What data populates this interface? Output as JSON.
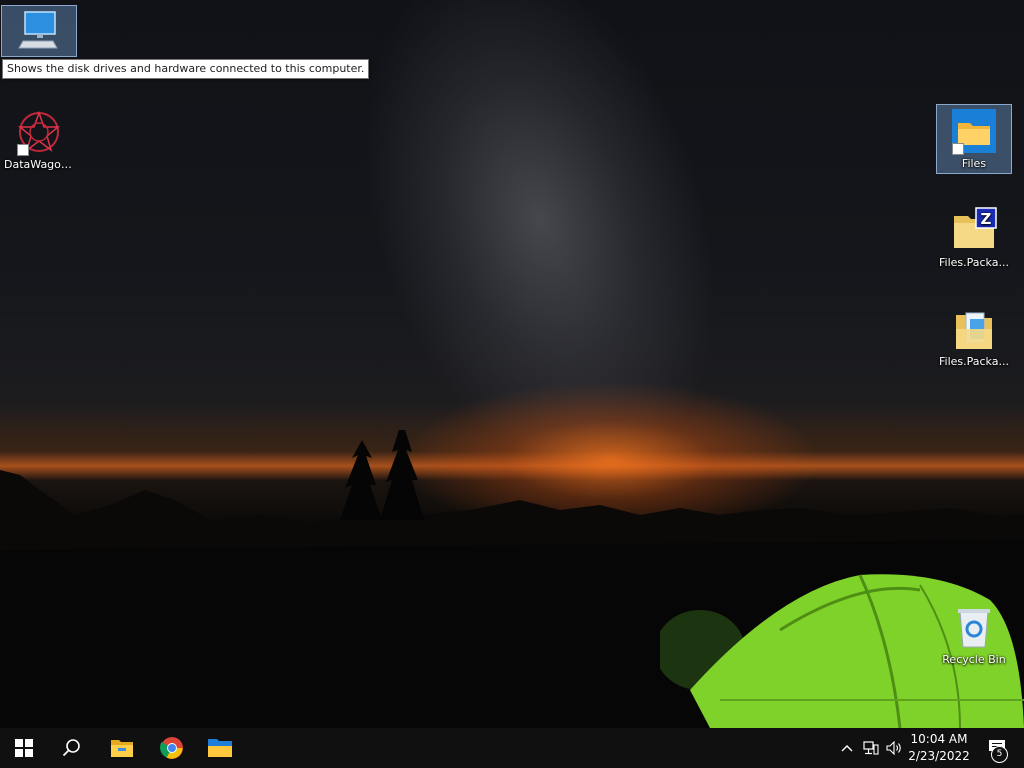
{
  "desktop": {
    "icons": {
      "this_pc": {
        "label": ""
      },
      "datawagon": {
        "label": "DataWagon..."
      },
      "files": {
        "label": "Files"
      },
      "files_package_1": {
        "label": "Files.Packa..."
      },
      "files_package_2": {
        "label": "Files.Packa..."
      },
      "recycle_bin": {
        "label": "Recycle Bin"
      }
    },
    "tooltip": "Shows the disk drives and hardware connected to this computer."
  },
  "taskbar": {
    "pinned": [
      "windows-start-icon",
      "search-icon",
      "file-explorer-icon",
      "chrome-icon",
      "files-app-icon"
    ],
    "clock": {
      "time": "10:04 AM",
      "date": "2/23/2022"
    },
    "notifications": {
      "count": "5"
    }
  },
  "colors": {
    "taskbar": "#101010",
    "selection": "#6e96c8",
    "tent": "#8fdc2a"
  }
}
